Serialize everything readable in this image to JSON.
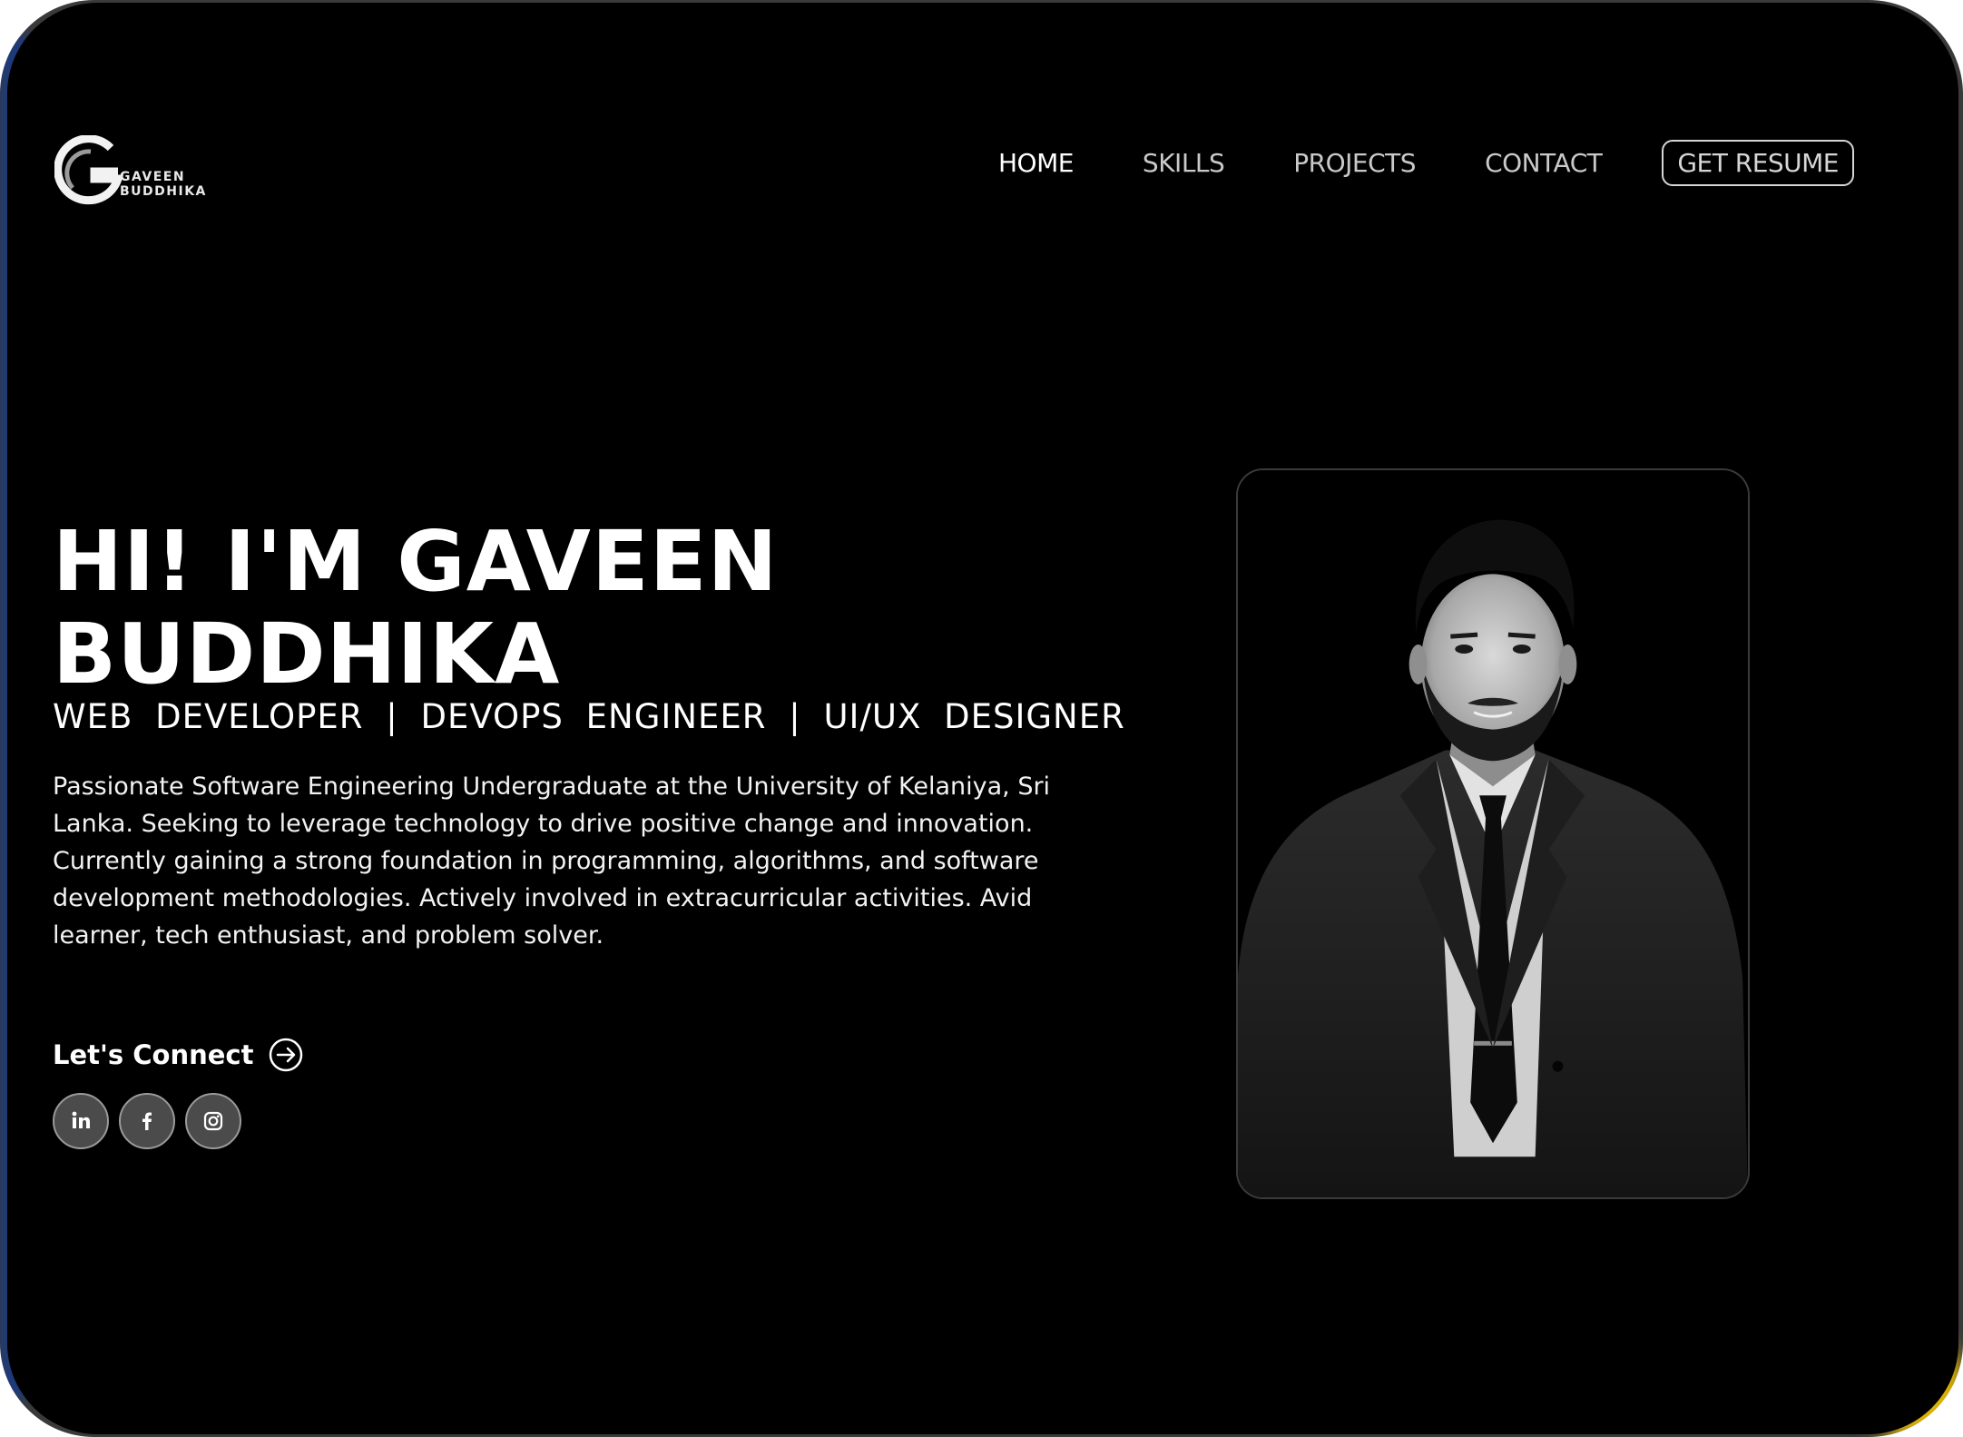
{
  "header": {
    "logo": {
      "letter": "G",
      "line1": "GAVEEN",
      "line2": "BUDDHIKA"
    },
    "nav": [
      {
        "label": "HOME",
        "active": true
      },
      {
        "label": "SKILLS",
        "active": false
      },
      {
        "label": "PROJECTS",
        "active": false
      },
      {
        "label": "CONTACT",
        "active": false
      }
    ],
    "resume_label": "GET RESUME"
  },
  "hero": {
    "title_line1": "HI! I'M GAVEEN",
    "title_line2": "BUDDHIKA",
    "subtitle": "WEB DEVELOPER | DEVOPS ENGINEER | UI/UX DESIGNER",
    "description": "Passionate Software Engineering Undergraduate at the University of Kelaniya, Sri Lanka. Seeking to leverage technology to drive positive change and innovation. Currently gaining a strong foundation in programming, algorithms, and software development methodologies. Actively involved in extracurricular activities. Avid learner, tech enthusiast, and problem solver.",
    "connect_label": "Let's Connect",
    "socials": [
      {
        "icon": "linkedin-icon",
        "glyph": "in"
      },
      {
        "icon": "facebook-icon",
        "glyph": "f"
      },
      {
        "icon": "instagram-icon",
        "glyph": ""
      }
    ]
  },
  "colors": {
    "background": "#000000",
    "text": "#ffffff",
    "nav_inactive": "#c9c9c9",
    "social_bg": "#4b4b4b"
  }
}
